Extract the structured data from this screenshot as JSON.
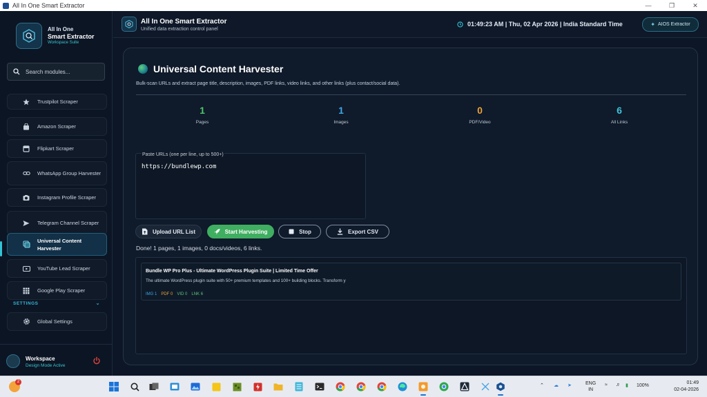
{
  "window": {
    "title": "All In One Smart Extractor"
  },
  "sidebar": {
    "brand": {
      "line1": "All In One",
      "line2": "Smart Extractor",
      "line3": "Workspace Suite"
    },
    "search_placeholder": "Search modules...",
    "items": [
      {
        "label": "Trustpilot Scraper",
        "icon": "star-icon"
      },
      {
        "label": "Amazon Scraper",
        "icon": "shopping-bag-icon"
      },
      {
        "label": "Flipkart Scraper",
        "icon": "store-icon"
      },
      {
        "label": "WhatsApp Group Harvester",
        "icon": "link-icon"
      },
      {
        "label": "Instagram Profile Scraper",
        "icon": "camera-icon"
      },
      {
        "label": "Telegram Channel Scraper",
        "icon": "send-icon"
      },
      {
        "label": "Universal Content Harvester",
        "icon": "layers-icon",
        "active": true
      },
      {
        "label": "YouTube Lead Scraper",
        "icon": "youtube-icon"
      },
      {
        "label": "Google Play Scraper",
        "icon": "grid-icon"
      }
    ],
    "settings_header": "SETTINGS",
    "settings_items": [
      {
        "label": "Global Settings",
        "icon": "gear-icon"
      }
    ],
    "workspace": {
      "title": "Workspace",
      "subtitle": "Design Mode Active"
    }
  },
  "header": {
    "title": "All In One Smart Extractor",
    "subtitle": "Unified data extraction control panel",
    "clock": "01:49:23 AM | Thu, 02 Apr 2026 | India Standard Time",
    "badge_button": "AIOS Extractor"
  },
  "main": {
    "title": "Universal Content Harvester",
    "description": "Bulk-scan URLs and extract page title, description, images, PDF links, video links, and other links (plus contact/social data).",
    "stats": [
      {
        "value": "1",
        "label": "Pages",
        "color": "#4fc46b"
      },
      {
        "value": "1",
        "label": "Images",
        "color": "#3ea6e6"
      },
      {
        "value": "0",
        "label": "PDF/Video",
        "color": "#e8a238"
      },
      {
        "value": "6",
        "label": "All Links",
        "color": "#3ec3d9"
      }
    ],
    "urls_label": "Paste URLs (one per line, up to 500+)",
    "urls_value": "https://bundlewp.com",
    "buttons": {
      "upload": "Upload URL List",
      "start": "Start Harvesting",
      "stop": "Stop",
      "export": "Export CSV"
    },
    "status": "Done! 1 pages, 1 images, 0 docs/videos, 6 links.",
    "results": [
      {
        "title": "Bundle WP Pro Plus - Ultimate WordPress Plugin Suite | Limited Time Offer",
        "description": "The ultimate WordPress plugin suite with 50+ premium templates and 100+ building blocks. Transform y",
        "tags": {
          "img": "IMG 1",
          "pdf": "PDF 0",
          "vid": "VID 0",
          "lnk": "LNK 6"
        }
      }
    ]
  },
  "taskbar": {
    "weather_badge": "2",
    "lang_line1": "ENG",
    "lang_line2": "IN",
    "battery": "100%",
    "time": "01:49",
    "date": "02-04-2026"
  },
  "colors": {
    "accent": "#33c3d6",
    "start_button": "#3fae60",
    "background": "#0d1626"
  }
}
